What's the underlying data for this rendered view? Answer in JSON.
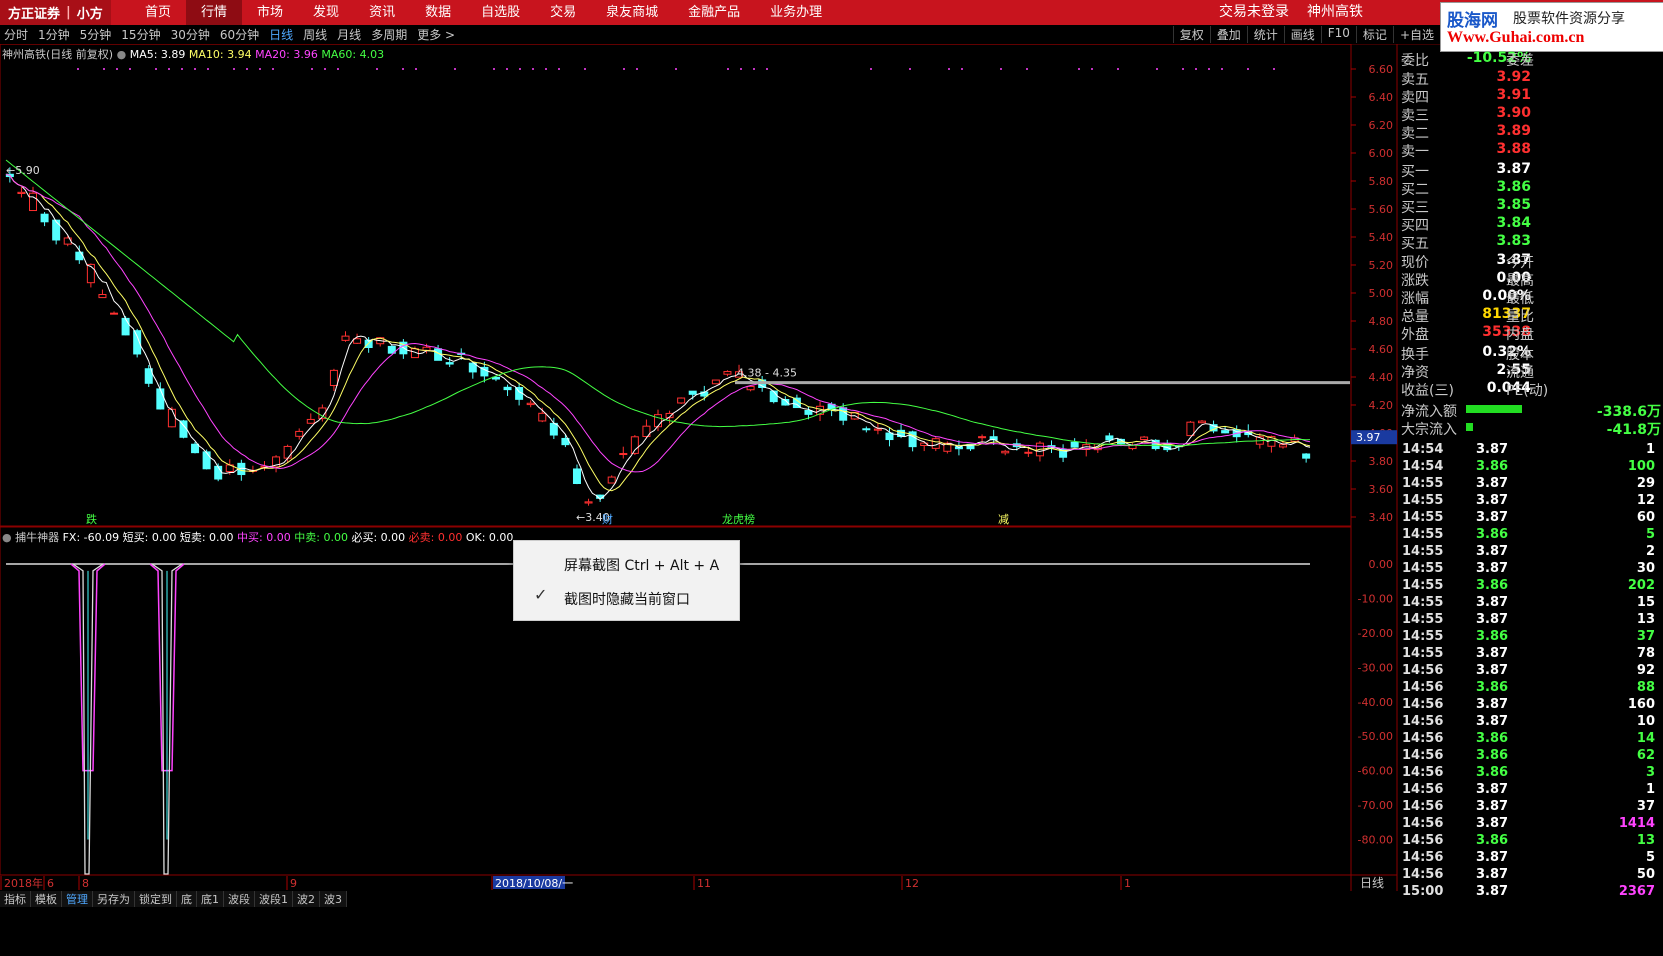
{
  "brand": {
    "name": "方正证券",
    "sub": "小方"
  },
  "nav": [
    "首页",
    "行情",
    "市场",
    "发现",
    "资讯",
    "数据",
    "自选股",
    "交易",
    "泉友商城",
    "金融产品",
    "业务办理"
  ],
  "nav_active": 1,
  "login": {
    "status": "交易未登录",
    "stock": "神州高铁"
  },
  "watermark": {
    "line1a": "股海网",
    "line1b": "股票软件资源分享",
    "line2": "Www.Guhai.com.cn"
  },
  "periods": [
    "分时",
    "1分钟",
    "5分钟",
    "15分钟",
    "30分钟",
    "60分钟",
    "日线",
    "周线",
    "月线",
    "多周期",
    "更多 >"
  ],
  "period_active": 6,
  "tools": [
    "复权",
    "叠加",
    "统计",
    "画线",
    "F10",
    "标记",
    "+自选"
  ],
  "chart_header": {
    "title": "神州高铁(日线 前复权)",
    "ma5": "MA5: 3.89",
    "ma10": "MA10: 3.94",
    "ma20": "MA20: 3.96",
    "ma60": "MA60: 4.03"
  },
  "indicator_header": {
    "name": "捕牛神器",
    "fx": "FX: -60.09",
    "short_buy": "短买: 0.00",
    "short_sell": "短卖: 0.00",
    "mid_buy": "中买: 0.00",
    "mid_sell": "中卖: 0.00",
    "must_buy": "必买: 0.00",
    "must_sell": "必卖: 0.00",
    "ok": "OK: 0.00"
  },
  "chart_data": {
    "type": "candlestick",
    "price_axis": [
      "6.60",
      "6.40",
      "6.20",
      "6.00",
      "5.80",
      "5.60",
      "5.40",
      "5.20",
      "5.00",
      "4.80",
      "4.60",
      "4.40",
      "4.20",
      "4.00",
      "3.80",
      "3.60",
      "3.40"
    ],
    "price_range": [
      3.35,
      6.65
    ],
    "indicator_axis": [
      "0.00",
      "-10.00",
      "-20.00",
      "-30.00",
      "-40.00",
      "-50.00",
      "-60.00",
      "-70.00",
      "-80.00"
    ],
    "current_price_tag": "3.97",
    "annotations": {
      "high": "5.90",
      "low": "3.40",
      "range": "4.38 - 4.35",
      "event1": "跌",
      "event2": "财",
      "event3": "龙虎榜",
      "event4": "减"
    },
    "date_axis": [
      "2018年",
      "6",
      "8",
      "9",
      "2018/10/08/一",
      "11",
      "12",
      "1"
    ]
  },
  "orderbook": {
    "header": {
      "label": "委比",
      "value": "-10.52%",
      "label2": "委差"
    },
    "asks": [
      {
        "label": "卖五",
        "price": "3.92"
      },
      {
        "label": "卖四",
        "price": "3.91"
      },
      {
        "label": "卖三",
        "price": "3.90"
      },
      {
        "label": "卖二",
        "price": "3.89"
      },
      {
        "label": "卖一",
        "price": "3.88"
      }
    ],
    "bids": [
      {
        "label": "买一",
        "price": "3.87"
      },
      {
        "label": "买二",
        "price": "3.86"
      },
      {
        "label": "买三",
        "price": "3.85"
      },
      {
        "label": "买四",
        "price": "3.84"
      },
      {
        "label": "买五",
        "price": "3.83"
      }
    ],
    "stats": [
      {
        "label": "现价",
        "value": "3.87",
        "label2": "今开",
        "color": "#ffffff"
      },
      {
        "label": "涨跌",
        "value": "0.00",
        "label2": "最高",
        "color": "#ffffff"
      },
      {
        "label": "涨幅",
        "value": "0.00%",
        "label2": "最低",
        "color": "#ffffff"
      },
      {
        "label": "总量",
        "value": "81337",
        "label2": "量比",
        "color": "#ffd700"
      },
      {
        "label": "外盘",
        "value": "35338",
        "label2": "内盘",
        "color": "#ff3030"
      },
      {
        "label": "换手",
        "value": "0.32%",
        "label2": "股本",
        "color": "#ffffff"
      },
      {
        "label": "净资",
        "value": "2.55",
        "label2": "流通",
        "color": "#ffffff"
      },
      {
        "label": "收益(三)",
        "value": "0.044",
        "label2": "PE(动)",
        "color": "#ffffff"
      }
    ],
    "flows": [
      {
        "label": "净流入额",
        "value": "-338.6万",
        "bar": 0.8
      },
      {
        "label": "大宗流入",
        "value": "-41.8万",
        "bar": 0.1
      }
    ]
  },
  "ticks": [
    {
      "t": "14:54",
      "p": "3.87",
      "v": "1",
      "c": "w"
    },
    {
      "t": "14:54",
      "p": "3.86",
      "v": "100",
      "c": "g"
    },
    {
      "t": "14:55",
      "p": "3.87",
      "v": "29",
      "c": "w"
    },
    {
      "t": "14:55",
      "p": "3.87",
      "v": "12",
      "c": "w"
    },
    {
      "t": "14:55",
      "p": "3.87",
      "v": "60",
      "c": "w"
    },
    {
      "t": "14:55",
      "p": "3.86",
      "v": "5",
      "c": "g"
    },
    {
      "t": "14:55",
      "p": "3.87",
      "v": "2",
      "c": "w"
    },
    {
      "t": "14:55",
      "p": "3.87",
      "v": "30",
      "c": "w"
    },
    {
      "t": "14:55",
      "p": "3.86",
      "v": "202",
      "c": "g"
    },
    {
      "t": "14:55",
      "p": "3.87",
      "v": "15",
      "c": "w"
    },
    {
      "t": "14:55",
      "p": "3.87",
      "v": "13",
      "c": "w"
    },
    {
      "t": "14:55",
      "p": "3.86",
      "v": "37",
      "c": "g"
    },
    {
      "t": "14:55",
      "p": "3.87",
      "v": "78",
      "c": "w"
    },
    {
      "t": "14:56",
      "p": "3.87",
      "v": "92",
      "c": "w"
    },
    {
      "t": "14:56",
      "p": "3.86",
      "v": "88",
      "c": "g"
    },
    {
      "t": "14:56",
      "p": "3.87",
      "v": "160",
      "c": "w"
    },
    {
      "t": "14:56",
      "p": "3.87",
      "v": "10",
      "c": "w"
    },
    {
      "t": "14:56",
      "p": "3.86",
      "v": "14",
      "c": "g"
    },
    {
      "t": "14:56",
      "p": "3.86",
      "v": "62",
      "c": "g"
    },
    {
      "t": "14:56",
      "p": "3.86",
      "v": "3",
      "c": "g"
    },
    {
      "t": "14:56",
      "p": "3.87",
      "v": "1",
      "c": "w"
    },
    {
      "t": "14:56",
      "p": "3.87",
      "v": "37",
      "c": "w"
    },
    {
      "t": "14:56",
      "p": "3.87",
      "v": "1414",
      "c": "m"
    },
    {
      "t": "14:56",
      "p": "3.86",
      "v": "13",
      "c": "g"
    },
    {
      "t": "14:56",
      "p": "3.87",
      "v": "5",
      "c": "w"
    },
    {
      "t": "14:56",
      "p": "3.87",
      "v": "50",
      "c": "w"
    },
    {
      "t": "15:00",
      "p": "3.87",
      "v": "2367",
      "c": "m"
    }
  ],
  "context_menu": {
    "item1": "屏幕截图 Ctrl + Alt + A",
    "item2": "截图时隐藏当前窗口",
    "item2_checked": true
  },
  "bottom_tabs": [
    "指标",
    "模板",
    "管理",
    "另存为",
    "锁定到",
    "底",
    "底1",
    "波段",
    "波段1",
    "波2",
    "波3"
  ],
  "bottom_active": 2,
  "daily_button": "日线",
  "colors": {
    "up": "#ff3030",
    "down": "#54ffff",
    "ma5": "#ffffff",
    "ma10": "#ffff66",
    "ma20": "#ff44ff",
    "ma60": "#44ff44",
    "bg": "#000000",
    "grid": "#5a0000"
  }
}
